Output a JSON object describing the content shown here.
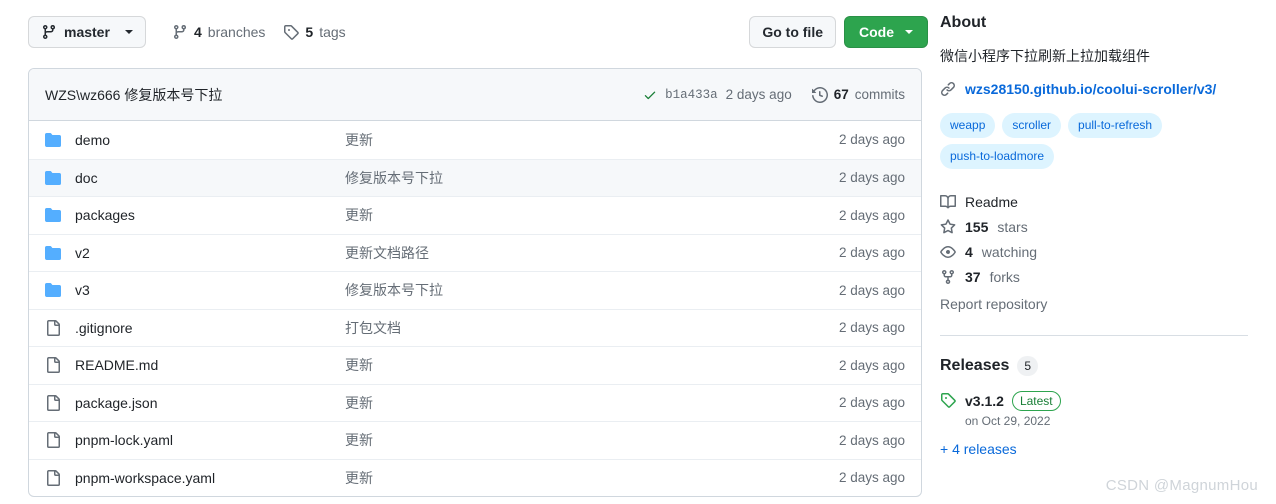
{
  "toolbar": {
    "branch": "master",
    "branches_count": "4",
    "branches_label": "branches",
    "tags_count": "5",
    "tags_label": "tags",
    "go_to_file": "Go to file",
    "code": "Code"
  },
  "commit_bar": {
    "message": "WZS\\wz666 修复版本号下拉",
    "sha": "b1a433a",
    "when": "2 days ago",
    "commits_count": "67",
    "commits_label": "commits"
  },
  "files": [
    {
      "icon": "folder-icon",
      "type": "folder",
      "name": "demo",
      "message": "更新",
      "when": "2 days ago",
      "hovered": false
    },
    {
      "icon": "folder-icon",
      "type": "folder",
      "name": "doc",
      "message": "修复版本号下拉",
      "when": "2 days ago",
      "hovered": true
    },
    {
      "icon": "folder-icon",
      "type": "folder",
      "name": "packages",
      "message": "更新",
      "when": "2 days ago",
      "hovered": false
    },
    {
      "icon": "folder-icon",
      "type": "folder",
      "name": "v2",
      "message": "更新文档路径",
      "when": "2 days ago",
      "hovered": false
    },
    {
      "icon": "folder-icon",
      "type": "folder",
      "name": "v3",
      "message": "修复版本号下拉",
      "when": "2 days ago",
      "hovered": false
    },
    {
      "icon": "file-icon",
      "type": "file",
      "name": ".gitignore",
      "message": "打包文档",
      "when": "2 days ago",
      "hovered": false
    },
    {
      "icon": "file-icon",
      "type": "file",
      "name": "README.md",
      "message": "更新",
      "when": "2 days ago",
      "hovered": false
    },
    {
      "icon": "file-icon",
      "type": "file",
      "name": "package.json",
      "message": "更新",
      "when": "2 days ago",
      "hovered": false
    },
    {
      "icon": "file-icon",
      "type": "file",
      "name": "pnpm-lock.yaml",
      "message": "更新",
      "when": "2 days ago",
      "hovered": false
    },
    {
      "icon": "file-icon",
      "type": "file",
      "name": "pnpm-workspace.yaml",
      "message": "更新",
      "when": "2 days ago",
      "hovered": false
    }
  ],
  "about": {
    "title": "About",
    "description": "微信小程序下拉刷新上拉加载组件",
    "homepage": "wzs28150.github.io/coolui-scroller/v3/",
    "topics": [
      "weapp",
      "scroller",
      "pull-to-refresh",
      "push-to-loadmore"
    ],
    "stats": [
      {
        "icon": "book-icon",
        "num": "",
        "label": "Readme"
      },
      {
        "icon": "star-icon",
        "num": "155",
        "label": "stars"
      },
      {
        "icon": "eye-icon",
        "num": "4",
        "label": "watching"
      },
      {
        "icon": "fork-icon",
        "num": "37",
        "label": "forks"
      }
    ],
    "report": "Report repository"
  },
  "releases": {
    "title": "Releases",
    "count": "5",
    "latest_version": "v3.1.2",
    "latest_badge": "Latest",
    "latest_date": "on Oct 29, 2022",
    "more": "+ 4 releases"
  },
  "watermark": "CSDN @MagnumHou",
  "colors": {
    "accent_blue": "#0969da",
    "code_green": "#2da44e",
    "check_green": "#1a7f37",
    "folder_blue": "#54aeff",
    "topic_bg": "#ddf4ff",
    "border": "#d0d7de",
    "muted": "#656d76"
  }
}
